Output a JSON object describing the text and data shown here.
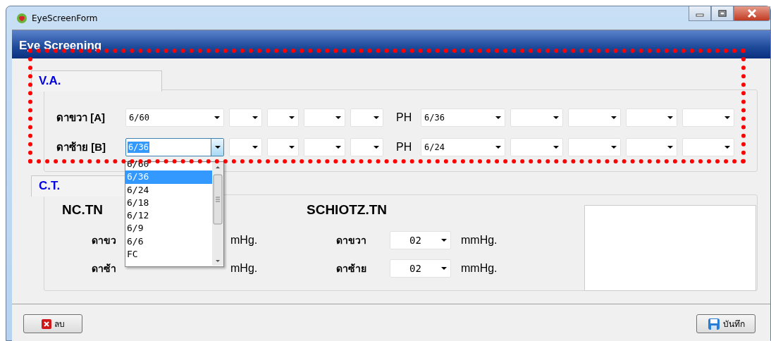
{
  "window": {
    "title": "EyeScreenForm"
  },
  "header": {
    "title": "Eye Screening"
  },
  "va": {
    "tab": "V.A.",
    "rows": [
      {
        "label": "ดาขวา [A]",
        "combos": [
          {
            "value": "6/60",
            "focused": false
          },
          {
            "focused": false
          },
          {
            "focused": false
          },
          {
            "focused": false
          },
          {
            "focused": false
          }
        ],
        "ph_label": "PH",
        "ph_combos": [
          {
            "value": "6/36",
            "focused": false
          },
          {
            "focused": false
          },
          {
            "focused": false
          },
          {
            "focused": false
          },
          {
            "focused": false
          }
        ]
      },
      {
        "label": "ดาซ้าย [B]",
        "combos": [
          {
            "value": "6/36",
            "focused": true
          },
          {
            "focused": false
          },
          {
            "focused": false
          },
          {
            "focused": false
          },
          {
            "focused": false
          }
        ],
        "ph_label": "PH",
        "ph_combos": [
          {
            "value": "6/24",
            "focused": false
          },
          {
            "focused": false
          },
          {
            "focused": false
          },
          {
            "focused": false
          },
          {
            "focused": false
          }
        ]
      }
    ]
  },
  "dropdown": {
    "open": true,
    "options": [
      {
        "label": "6/60",
        "selected": false
      },
      {
        "label": "6/36",
        "selected": true
      },
      {
        "label": "6/24",
        "selected": false
      },
      {
        "label": "6/18",
        "selected": false
      },
      {
        "label": "6/12",
        "selected": false
      },
      {
        "label": "6/9",
        "selected": false
      },
      {
        "label": "6/6",
        "selected": false
      },
      {
        "label": "FC",
        "selected": false
      }
    ]
  },
  "ct": {
    "tab": "C.T.",
    "nc": {
      "title": "NC.TN",
      "rows": [
        {
          "label": "ดาขว",
          "unit": "mHg."
        },
        {
          "label": "ดาซ้า",
          "unit": "mHg."
        }
      ]
    },
    "schiotz": {
      "title": "SCHIOTZ.TN",
      "rows": [
        {
          "label": "ดาขวา",
          "value": "02",
          "unit": "mmHg."
        },
        {
          "label": "ดาซ้าย",
          "value": "02",
          "unit": "mmHg."
        }
      ]
    }
  },
  "buttons": [
    {
      "kind": "delete",
      "label": "ลบ"
    },
    {
      "kind": "save",
      "label": "บันทึก"
    }
  ],
  "annotation": {
    "kind": "dotted-frame"
  }
}
